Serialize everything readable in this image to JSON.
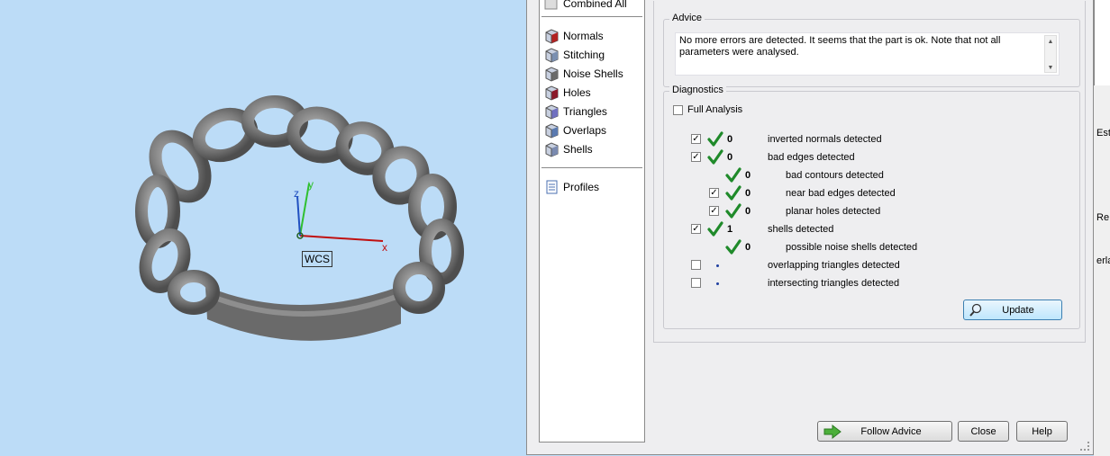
{
  "viewport": {
    "axes": {
      "x": "x",
      "y": "y",
      "z": "z"
    },
    "wcs_label": "WCS"
  },
  "nav": {
    "top_partial": "Combined All",
    "items": [
      {
        "label": "Normals",
        "icon": "normals-icon"
      },
      {
        "label": "Stitching",
        "icon": "stitching-icon"
      },
      {
        "label": "Noise Shells",
        "icon": "noise-shells-icon"
      },
      {
        "label": "Holes",
        "icon": "holes-icon"
      },
      {
        "label": "Triangles",
        "icon": "triangles-icon"
      },
      {
        "label": "Overlaps",
        "icon": "overlaps-icon"
      },
      {
        "label": "Shells",
        "icon": "shells-icon"
      }
    ],
    "profiles": "Profiles"
  },
  "advice": {
    "title": "Advice",
    "line1": "No more errors are detected. It seems that the part is ok. Note that not all",
    "line2": "parameters were analysed."
  },
  "diagnostics": {
    "title": "Diagnostics",
    "full_analysis": "Full Analysis",
    "rows": [
      {
        "count": "0",
        "label": "inverted normals detected"
      },
      {
        "count": "0",
        "label": "bad edges detected"
      },
      {
        "count": "0",
        "label": "bad contours detected"
      },
      {
        "count": "0",
        "label": "near bad edges detected"
      },
      {
        "count": "0",
        "label": "planar holes detected"
      },
      {
        "count": "1",
        "label": "shells detected"
      },
      {
        "count": "0",
        "label": "possible noise shells detected"
      },
      {
        "count": "",
        "label": "overlapping triangles detected"
      },
      {
        "count": "",
        "label": "intersecting triangles detected"
      }
    ],
    "update": "Update"
  },
  "buttons": {
    "follow_advice": "Follow Advice",
    "close": "Close",
    "help": "Help"
  },
  "right_strip": {
    "t1": "Est",
    "t2": "Re",
    "t3": "erla"
  },
  "colors": {
    "viewport_bg": "#bcdcf7",
    "check_green": "#1f8a2a",
    "axis_x": "#c01010",
    "axis_y": "#30c030",
    "axis_z": "#2050c0"
  }
}
